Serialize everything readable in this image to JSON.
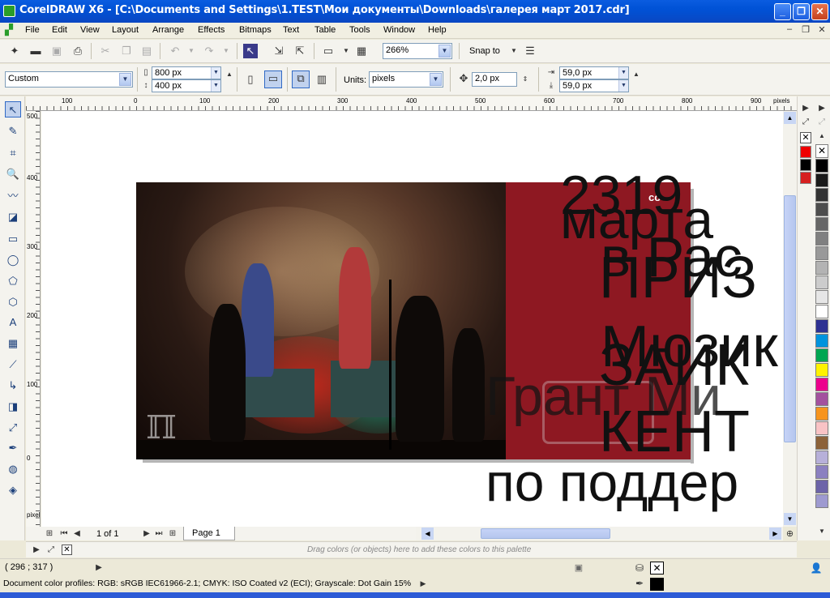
{
  "window": {
    "title": "CorelDRAW X6 - [C:\\Documents and Settings\\1.TEST\\Мои документы\\Downloads\\галерея март 2017.cdr]"
  },
  "menu": [
    "File",
    "Edit",
    "View",
    "Layout",
    "Arrange",
    "Effects",
    "Bitmaps",
    "Text",
    "Table",
    "Tools",
    "Window",
    "Help"
  ],
  "toolbar": {
    "zoom": "266%",
    "snap_label": "Snap to"
  },
  "property_bar": {
    "page_preset": "Custom",
    "width": "800 px",
    "height": "400 px",
    "units_label": "Units:",
    "units": "pixels",
    "nudge": "2,0 px",
    "dup_x": "59,0 px",
    "dup_y": "59,0 px"
  },
  "ruler": {
    "h_ticks": [
      "100",
      "0",
      "100",
      "200",
      "300",
      "400",
      "500",
      "600",
      "700",
      "800",
      "900"
    ],
    "h_unit": "pixels",
    "v_ticks": [
      "500",
      "400",
      "300",
      "200",
      "100",
      "0"
    ],
    "v_unit": "pixels"
  },
  "canvas_text": {
    "t1": "2319",
    "t2": "марта",
    "t3": "в Рас",
    "t4": "ПРИЗ",
    "t5": "Мюзик",
    "t6": "ЗАИК",
    "t7": "Грант Ми",
    "t8": "КЕНТ",
    "t9": "по поддер",
    "small": "со"
  },
  "page_nav": {
    "count": "1 of 1",
    "tab": "Page 1"
  },
  "palette_hint": "Drag colors (or objects) here to add these colors to this palette",
  "status": {
    "coords": "( 296 ; 317 )",
    "profiles": "Document color profiles: RGB: sRGB IEC61966-2.1; CMYK: ISO Coated v2 (ECI); Grayscale: Dot Gain 15%"
  },
  "colors": {
    "panel_red": "#8e1822",
    "title_blue": "#0052d6",
    "palette": [
      "#000000",
      "#1a1a1a",
      "#333333",
      "#4d4d4d",
      "#666666",
      "#808080",
      "#999999",
      "#b3b3b3",
      "#cccccc",
      "#e6e6e6",
      "#ffffff",
      "#2e3192",
      "#0093dd",
      "#00a651",
      "#fff200",
      "#ec008c",
      "#a3519e",
      "#f7941d",
      "#f9c3c5",
      "#8c6239",
      "#b7b0d9",
      "#8b80c0",
      "#6d64a8",
      "#9e9ad0"
    ]
  }
}
